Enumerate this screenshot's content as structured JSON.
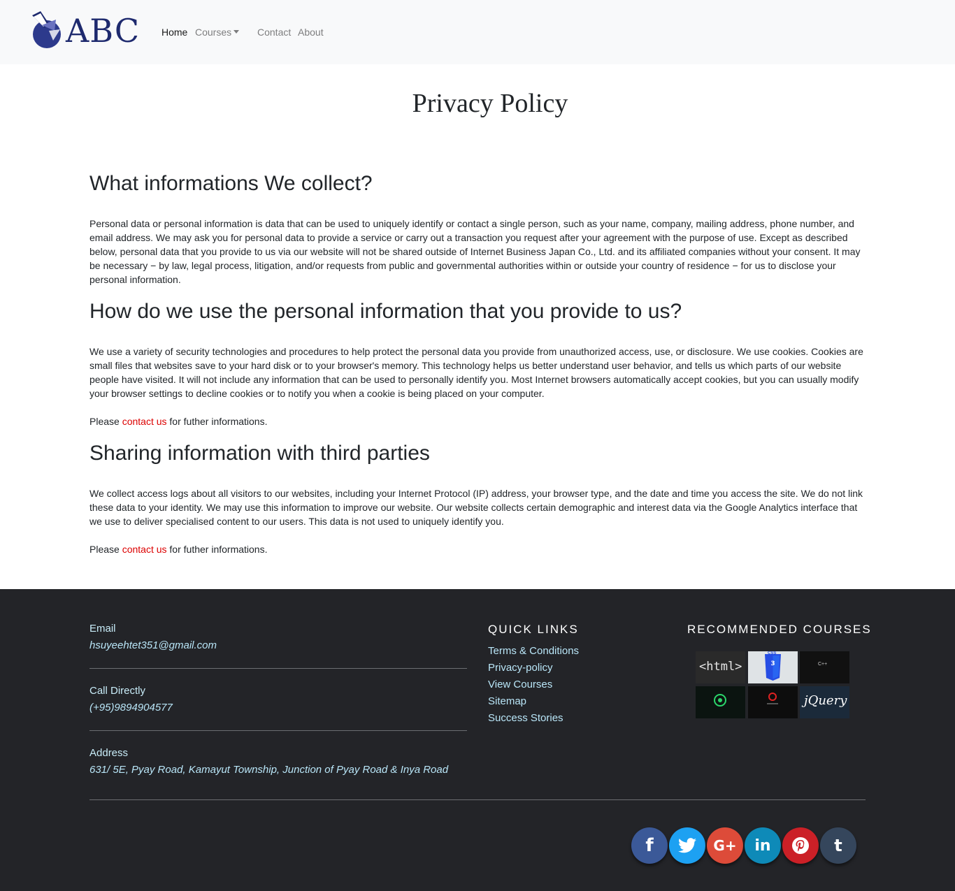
{
  "nav": {
    "logo_text": "ABC",
    "items": [
      {
        "label": "Home"
      },
      {
        "label": "Courses"
      },
      {
        "label": "Contact"
      },
      {
        "label": "About"
      }
    ]
  },
  "page": {
    "title": "Privacy Policy",
    "sections": [
      {
        "heading": "What informations We collect?",
        "body": "Personal data or personal information is data that can be used to uniquely identify or contact a single person, such as your name, company, mailing address, phone number, and email address. We may ask you for personal data to provide a service or carry out a transaction you request after your agreement with the purpose of use. Except as described below, personal data that you provide to us via our website will not be shared outside of Internet Business Japan Co., Ltd. and its affiliated companies without your consent. It may be necessary − by law, legal process, litigation, and/or requests from public and governmental authorities within or outside your country of residence − for us to disclose your personal information."
      },
      {
        "heading": "How do we use the personal information that you provide to us?",
        "body": "We use a variety of security technologies and procedures to help protect the personal data you provide from unauthorized access, use, or disclosure. We use cookies. Cookies are small files that websites save to your hard disk or to your browser's memory. This technology helps us better understand user behavior, and tells us which parts of our website people have visited. It will not include any information that can be used to personally identify you. Most Internet browsers automatically accept cookies, but you can usually modify your browser settings to decline cookies or to notify you when a cookie is being placed on your computer.",
        "contact_prefix": "Please ",
        "contact_link": "contact us",
        "contact_suffix": " for futher informations."
      },
      {
        "heading": "Sharing information with third parties",
        "body": "We collect access logs about all visitors to our websites, including your Internet Protocol (IP) address, your browser type, and the date and time you access the site. We do not link these data to your identity. We may use this information to improve our website. Our website collects certain demographic and interest data via the Google Analytics interface that we use to deliver specialised content to our users. This data is not used to uniquely identify you.",
        "contact_prefix": "Please ",
        "contact_link": "contact us",
        "contact_suffix": " for futher informations."
      }
    ]
  },
  "footer": {
    "contact": [
      {
        "label": "Email",
        "value": "hsuyeehtet351@gmail.com"
      },
      {
        "label": "Call Directly",
        "value": "(+95)9894904577"
      },
      {
        "label": "Address",
        "value": "631/ 5E, Pyay Road, Kamayut Township, Junction of Pyay Road & Inya Road"
      }
    ],
    "quick_links_heading": "QUICK LINKS",
    "quick_links": [
      "Terms & Conditions",
      "Privacy-policy",
      "View Courses",
      "Sitemap",
      "Success Stories"
    ],
    "recommended_heading": "RECOMMENDED COURSES",
    "course_tiles": [
      {
        "text": "<html>",
        "icon": "html-icon"
      },
      {
        "text": "CSS",
        "icon": "css3-icon"
      },
      {
        "text": "C++",
        "icon": "cpp-icon"
      },
      {
        "text": "",
        "icon": "green-tech-icon"
      },
      {
        "text": "",
        "icon": "red-tech-icon"
      },
      {
        "text": "jQuery",
        "icon": "jquery-icon"
      }
    ],
    "social": [
      {
        "icon": "facebook-icon",
        "glyph": "f",
        "color": "#3b5998"
      },
      {
        "icon": "twitter-icon",
        "glyph": "t",
        "color": "#1da1f2"
      },
      {
        "icon": "google-plus-icon",
        "glyph": "G+",
        "color": "#dd4b39"
      },
      {
        "icon": "linkedin-icon",
        "glyph": "in",
        "color": "#0e8ab8"
      },
      {
        "icon": "pinterest-icon",
        "glyph": "P",
        "color": "#cb2027"
      },
      {
        "icon": "tumblr-icon",
        "glyph": "t",
        "color": "#35465c"
      }
    ]
  }
}
